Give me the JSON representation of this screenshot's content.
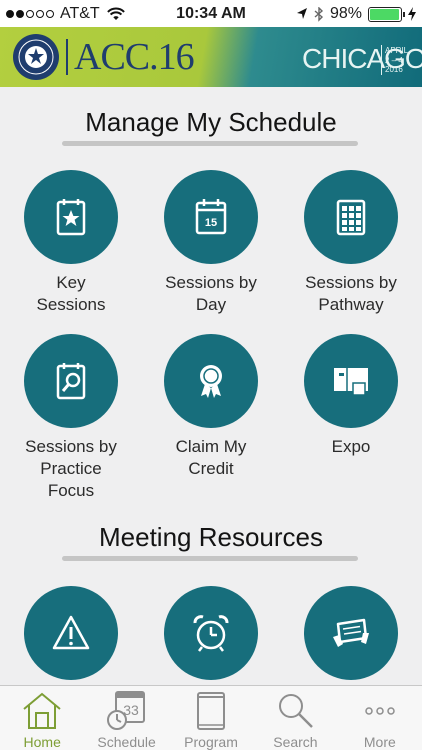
{
  "status_bar": {
    "carrier": "AT&T",
    "time": "10:34 AM",
    "battery": "98%",
    "battery_level": 0.98
  },
  "banner": {
    "event": "ACC.16",
    "city": "CHICAGO",
    "dates_line1": "APRIL",
    "dates_line2": "2 – 4",
    "dates_line3": "2016"
  },
  "sections": {
    "schedule_title": "Manage My Schedule",
    "resources_title": "Meeting Resources"
  },
  "schedule_tiles": [
    {
      "line1": "Key",
      "line2": "Sessions",
      "line3": "",
      "icon": "star-calendar-icon"
    },
    {
      "line1": "Sessions by",
      "line2": "Day",
      "line3": "",
      "icon": "calendar-day-icon"
    },
    {
      "line1": "Sessions by",
      "line2": "Pathway",
      "line3": "",
      "icon": "grid-calendar-icon"
    },
    {
      "line1": "Sessions by",
      "line2": "Practice",
      "line3": "Focus",
      "icon": "magnifier-calendar-icon"
    },
    {
      "line1": "Claim My",
      "line2": "Credit",
      "line3": "",
      "icon": "award-ribbon-icon"
    },
    {
      "line1": "Expo",
      "line2": "",
      "line3": "",
      "icon": "expo-booth-icon"
    }
  ],
  "resource_tiles": [
    {
      "icon": "warning-icon"
    },
    {
      "icon": "alarm-clock-icon"
    },
    {
      "icon": "hands-sign-icon"
    }
  ],
  "tabs": [
    {
      "label": "Home",
      "icon": "home-icon",
      "active": true
    },
    {
      "label": "Schedule",
      "icon": "calendar-clock-icon",
      "active": false
    },
    {
      "label": "Program",
      "icon": "book-icon",
      "active": false
    },
    {
      "label": "Search",
      "icon": "search-icon",
      "active": false
    },
    {
      "label": "More",
      "icon": "more-icon",
      "active": false
    }
  ],
  "colors": {
    "tile": "#176e7c",
    "banner_green": "#b3cf3f",
    "banner_teal": "#116b7a",
    "tab_active": "#7d9e35",
    "tab_inactive": "#8e8e8e"
  }
}
